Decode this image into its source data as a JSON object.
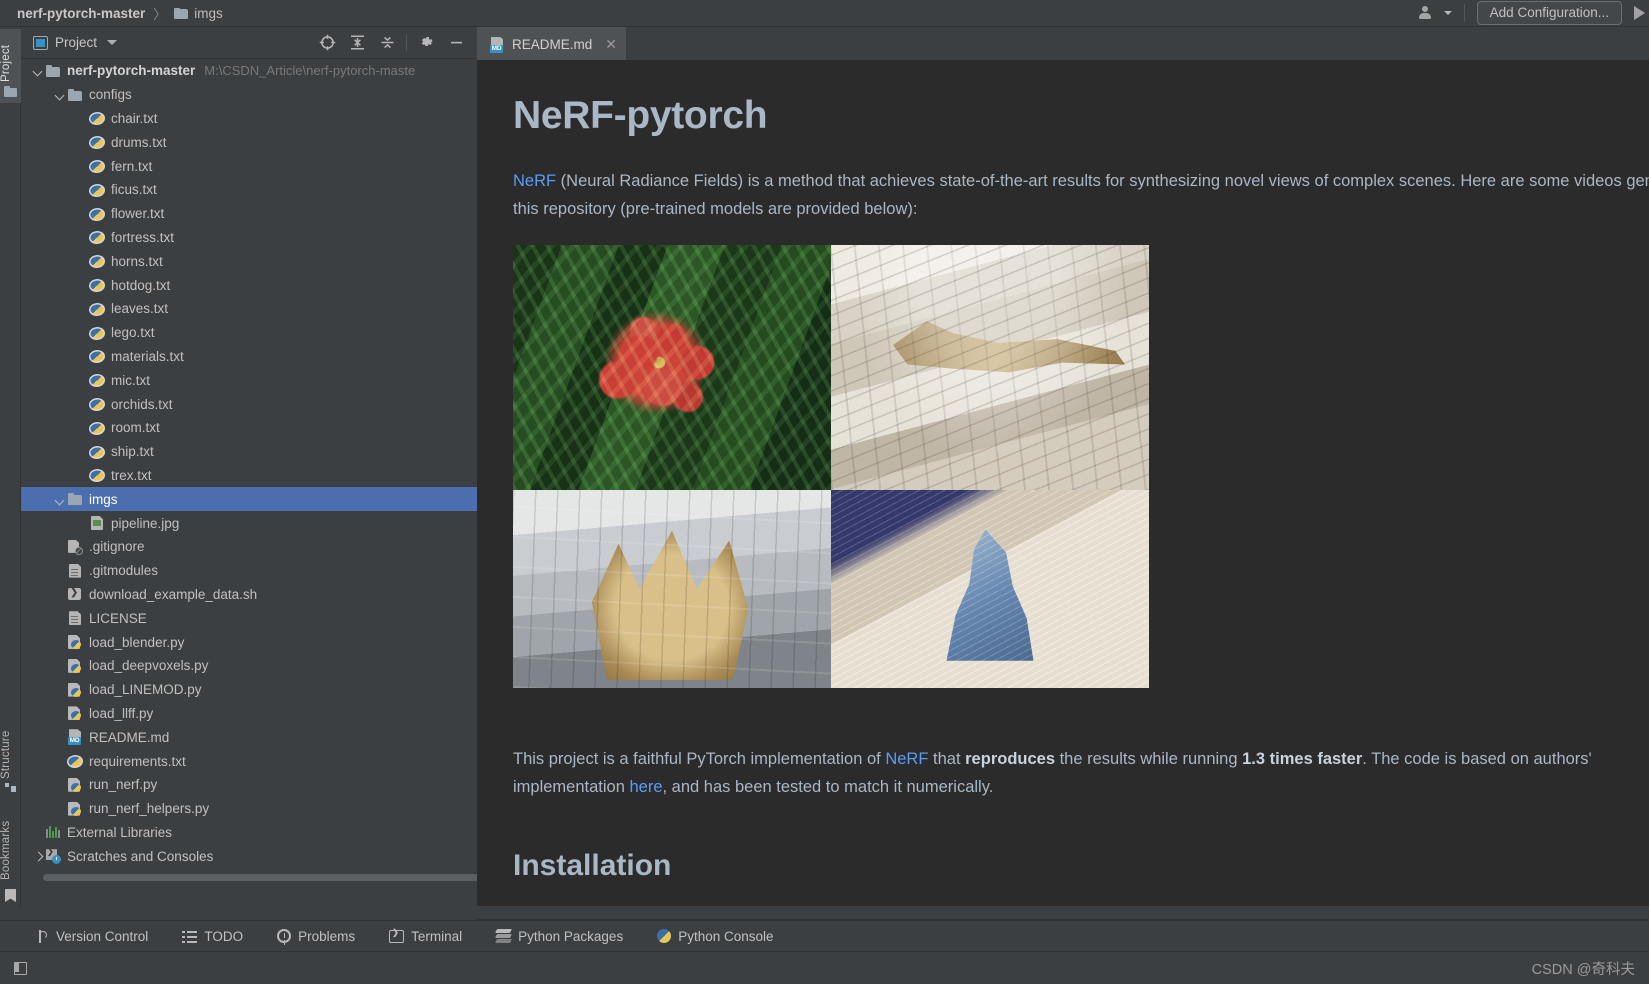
{
  "window": {
    "breadcrumb": [
      {
        "label": "nerf-pytorch-master",
        "bold": true,
        "icon": "none"
      },
      {
        "label": "imgs",
        "bold": false,
        "icon": "folder-icon"
      }
    ],
    "separator": "〉",
    "add_configuration": "Add Configuration...",
    "run_icon": "run-play-icon",
    "user_icon": "user-account-icon"
  },
  "toolstrip": {
    "project_tab": "Project",
    "structure_tab": "Structure",
    "bookmarks_tab": "Bookmarks"
  },
  "project_panel": {
    "title": "Project",
    "tool_icons": [
      "locate-target-icon",
      "expand-all-icon",
      "collapse-all-icon",
      "settings-gear-icon",
      "minimize-icon"
    ],
    "tree": [
      {
        "depth": 0,
        "chevron": "down",
        "icon": "folder-icon",
        "label": "nerf-pytorch-master",
        "bold": true,
        "path": "M:\\CSDN_Article\\nerf-pytorch-maste",
        "selected": false
      },
      {
        "depth": 1,
        "chevron": "down",
        "icon": "folder-icon",
        "label": "configs",
        "bold": false,
        "path": "",
        "selected": false
      },
      {
        "depth": 2,
        "chevron": "none",
        "icon": "python-package-icon",
        "label": "chair.txt",
        "bold": false,
        "path": "",
        "selected": false
      },
      {
        "depth": 2,
        "chevron": "none",
        "icon": "python-package-icon",
        "label": "drums.txt",
        "bold": false,
        "path": "",
        "selected": false
      },
      {
        "depth": 2,
        "chevron": "none",
        "icon": "python-package-icon",
        "label": "fern.txt",
        "bold": false,
        "path": "",
        "selected": false
      },
      {
        "depth": 2,
        "chevron": "none",
        "icon": "python-package-icon",
        "label": "ficus.txt",
        "bold": false,
        "path": "",
        "selected": false
      },
      {
        "depth": 2,
        "chevron": "none",
        "icon": "python-package-icon",
        "label": "flower.txt",
        "bold": false,
        "path": "",
        "selected": false
      },
      {
        "depth": 2,
        "chevron": "none",
        "icon": "python-package-icon",
        "label": "fortress.txt",
        "bold": false,
        "path": "",
        "selected": false
      },
      {
        "depth": 2,
        "chevron": "none",
        "icon": "python-package-icon",
        "label": "horns.txt",
        "bold": false,
        "path": "",
        "selected": false
      },
      {
        "depth": 2,
        "chevron": "none",
        "icon": "python-package-icon",
        "label": "hotdog.txt",
        "bold": false,
        "path": "",
        "selected": false
      },
      {
        "depth": 2,
        "chevron": "none",
        "icon": "python-package-icon",
        "label": "leaves.txt",
        "bold": false,
        "path": "",
        "selected": false
      },
      {
        "depth": 2,
        "chevron": "none",
        "icon": "python-package-icon",
        "label": "lego.txt",
        "bold": false,
        "path": "",
        "selected": false
      },
      {
        "depth": 2,
        "chevron": "none",
        "icon": "python-package-icon",
        "label": "materials.txt",
        "bold": false,
        "path": "",
        "selected": false
      },
      {
        "depth": 2,
        "chevron": "none",
        "icon": "python-package-icon",
        "label": "mic.txt",
        "bold": false,
        "path": "",
        "selected": false
      },
      {
        "depth": 2,
        "chevron": "none",
        "icon": "python-package-icon",
        "label": "orchids.txt",
        "bold": false,
        "path": "",
        "selected": false
      },
      {
        "depth": 2,
        "chevron": "none",
        "icon": "python-package-icon",
        "label": "room.txt",
        "bold": false,
        "path": "",
        "selected": false
      },
      {
        "depth": 2,
        "chevron": "none",
        "icon": "python-package-icon",
        "label": "ship.txt",
        "bold": false,
        "path": "",
        "selected": false
      },
      {
        "depth": 2,
        "chevron": "none",
        "icon": "python-package-icon",
        "label": "trex.txt",
        "bold": false,
        "path": "",
        "selected": false
      },
      {
        "depth": 1,
        "chevron": "down",
        "icon": "folder-icon",
        "label": "imgs",
        "bold": false,
        "path": "",
        "selected": true
      },
      {
        "depth": 2,
        "chevron": "none",
        "icon": "image-file-icon",
        "label": "pipeline.jpg",
        "bold": false,
        "path": "",
        "selected": false
      },
      {
        "depth": 1,
        "chevron": "none",
        "icon": "gitignore-icon",
        "label": ".gitignore",
        "bold": false,
        "path": "",
        "selected": false
      },
      {
        "depth": 1,
        "chevron": "none",
        "icon": "text-file-icon",
        "label": ".gitmodules",
        "bold": false,
        "path": "",
        "selected": false
      },
      {
        "depth": 1,
        "chevron": "none",
        "icon": "shell-script-icon",
        "label": "download_example_data.sh",
        "bold": false,
        "path": "",
        "selected": false
      },
      {
        "depth": 1,
        "chevron": "none",
        "icon": "text-file-icon",
        "label": "LICENSE",
        "bold": false,
        "path": "",
        "selected": false
      },
      {
        "depth": 1,
        "chevron": "none",
        "icon": "python-file-icon",
        "label": "load_blender.py",
        "bold": false,
        "path": "",
        "selected": false
      },
      {
        "depth": 1,
        "chevron": "none",
        "icon": "python-file-icon",
        "label": "load_deepvoxels.py",
        "bold": false,
        "path": "",
        "selected": false
      },
      {
        "depth": 1,
        "chevron": "none",
        "icon": "python-file-icon",
        "label": "load_LINEMOD.py",
        "bold": false,
        "path": "",
        "selected": false
      },
      {
        "depth": 1,
        "chevron": "none",
        "icon": "python-file-icon",
        "label": "load_llff.py",
        "bold": false,
        "path": "",
        "selected": false
      },
      {
        "depth": 1,
        "chevron": "none",
        "icon": "markdown-file-icon",
        "label": "README.md",
        "bold": false,
        "path": "",
        "selected": false
      },
      {
        "depth": 1,
        "chevron": "none",
        "icon": "python-package-icon",
        "label": "requirements.txt",
        "bold": false,
        "path": "",
        "selected": false
      },
      {
        "depth": 1,
        "chevron": "none",
        "icon": "python-file-icon",
        "label": "run_nerf.py",
        "bold": false,
        "path": "",
        "selected": false
      },
      {
        "depth": 1,
        "chevron": "none",
        "icon": "python-file-icon",
        "label": "run_nerf_helpers.py",
        "bold": false,
        "path": "",
        "selected": false
      },
      {
        "depth": 0,
        "chevron": "none",
        "icon": "external-libraries-icon",
        "label": "External Libraries",
        "bold": false,
        "path": "",
        "selected": false
      },
      {
        "depth": 0,
        "chevron": "right",
        "icon": "scratches-icon",
        "label": "Scratches and Consoles",
        "bold": false,
        "path": "",
        "selected": false
      }
    ]
  },
  "editor": {
    "tabs": [
      {
        "label": "README.md",
        "icon": "markdown-file-icon",
        "close": "✕",
        "active": true
      }
    ],
    "markdown": {
      "h1": "NeRF-pytorch",
      "para1": {
        "link": "NeRF",
        "text_after_link": " (Neural Radiance Fields) is a method that achieves state-of-the-art results for synthesizing novel views of complex scenes. Here are some videos generated by",
        "line2": "this repository (pre-trained models are provided below):"
      },
      "images": [
        {
          "name": "flower-preview",
          "alt": "red flower on green foliage"
        },
        {
          "name": "trex-preview",
          "alt": "t-rex skeleton in museum atrium"
        },
        {
          "name": "horns-preview",
          "alt": "triceratops skull in museum"
        },
        {
          "name": "ship-preview",
          "alt": "blue 3d-printed ship model on wood table"
        }
      ],
      "para2": {
        "seg1": "This project is a faithful PyTorch implementation of ",
        "link1": "NeRF",
        "seg2": " that ",
        "bold1": "reproduces",
        "seg3": " the results while running ",
        "bold2": "1.3 times faster",
        "seg4": ". The code is based on authors' ",
        "line2_seg1": "implementation ",
        "link2": "here",
        "line2_seg2": ", and has been tested to match it numerically."
      },
      "h2": "Installation"
    }
  },
  "bottom_bar": {
    "items": [
      {
        "label": "Version Control",
        "icon": "version-control-icon"
      },
      {
        "label": "TODO",
        "icon": "todo-list-icon"
      },
      {
        "label": "Problems",
        "icon": "problems-warning-icon"
      },
      {
        "label": "Terminal",
        "icon": "terminal-icon"
      },
      {
        "label": "Python Packages",
        "icon": "python-packages-icon"
      },
      {
        "label": "Python Console",
        "icon": "python-console-icon"
      }
    ]
  },
  "status_bar": {
    "layout_icon": "layout-toggle-icon",
    "watermark": "CSDN @奇科夫"
  },
  "colors": {
    "panel_bg": "#3c3f41",
    "editor_bg": "#2b2b2b",
    "selection": "#4b6eaf",
    "link": "#589df6",
    "text": "#a9b7c6",
    "tab_active": "#4e5254"
  }
}
